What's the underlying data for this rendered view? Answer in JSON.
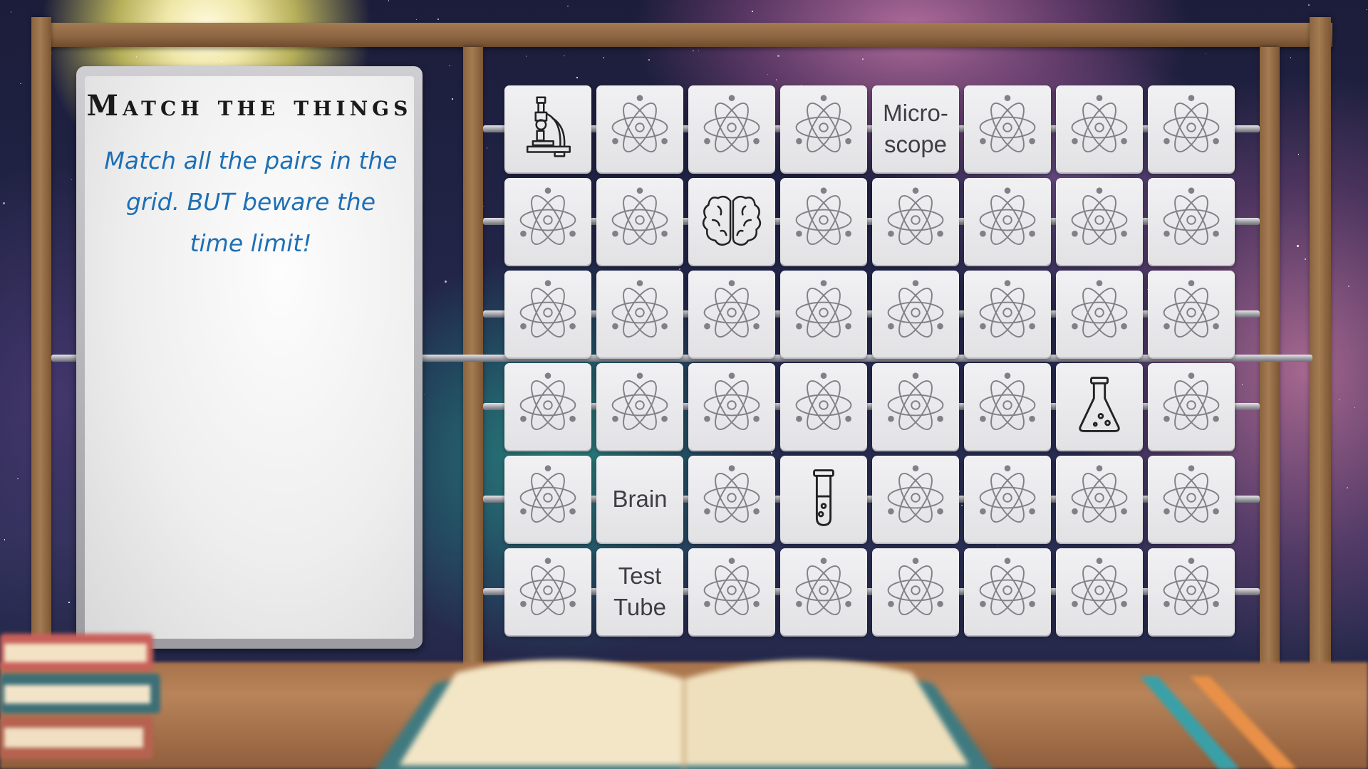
{
  "game": {
    "title": "Match the things",
    "instructions": "Match all the pairs in the grid. BUT beware the time limit!"
  },
  "colors": {
    "instruction_text": "#1e6fb5",
    "card_face": "#ececee",
    "card_icon": "#808086",
    "frame_wood": "#9a714a"
  },
  "grid": {
    "columns": 8,
    "rows": 6,
    "cards": [
      {
        "state": "revealed",
        "kind": "icon",
        "icon": "microscope-icon"
      },
      {
        "state": "hidden",
        "kind": "icon",
        "icon": "atom-icon"
      },
      {
        "state": "hidden",
        "kind": "icon",
        "icon": "atom-icon"
      },
      {
        "state": "hidden",
        "kind": "icon",
        "icon": "atom-icon"
      },
      {
        "state": "revealed",
        "kind": "text",
        "text": "Micro-\nscope"
      },
      {
        "state": "hidden",
        "kind": "icon",
        "icon": "atom-icon"
      },
      {
        "state": "hidden",
        "kind": "icon",
        "icon": "atom-icon"
      },
      {
        "state": "hidden",
        "kind": "icon",
        "icon": "atom-icon"
      },
      {
        "state": "hidden",
        "kind": "icon",
        "icon": "atom-icon"
      },
      {
        "state": "hidden",
        "kind": "icon",
        "icon": "atom-icon"
      },
      {
        "state": "revealed",
        "kind": "icon",
        "icon": "brain-icon"
      },
      {
        "state": "hidden",
        "kind": "icon",
        "icon": "atom-icon"
      },
      {
        "state": "hidden",
        "kind": "icon",
        "icon": "atom-icon"
      },
      {
        "state": "hidden",
        "kind": "icon",
        "icon": "atom-icon"
      },
      {
        "state": "hidden",
        "kind": "icon",
        "icon": "atom-icon"
      },
      {
        "state": "hidden",
        "kind": "icon",
        "icon": "atom-icon"
      },
      {
        "state": "hidden",
        "kind": "icon",
        "icon": "atom-icon"
      },
      {
        "state": "hidden",
        "kind": "icon",
        "icon": "atom-icon"
      },
      {
        "state": "hidden",
        "kind": "icon",
        "icon": "atom-icon"
      },
      {
        "state": "hidden",
        "kind": "icon",
        "icon": "atom-icon"
      },
      {
        "state": "hidden",
        "kind": "icon",
        "icon": "atom-icon"
      },
      {
        "state": "hidden",
        "kind": "icon",
        "icon": "atom-icon"
      },
      {
        "state": "hidden",
        "kind": "icon",
        "icon": "atom-icon"
      },
      {
        "state": "hidden",
        "kind": "icon",
        "icon": "atom-icon"
      },
      {
        "state": "hidden",
        "kind": "icon",
        "icon": "atom-icon"
      },
      {
        "state": "hidden",
        "kind": "icon",
        "icon": "atom-icon"
      },
      {
        "state": "hidden",
        "kind": "icon",
        "icon": "atom-icon"
      },
      {
        "state": "hidden",
        "kind": "icon",
        "icon": "atom-icon"
      },
      {
        "state": "hidden",
        "kind": "icon",
        "icon": "atom-icon"
      },
      {
        "state": "hidden",
        "kind": "icon",
        "icon": "atom-icon"
      },
      {
        "state": "revealed",
        "kind": "icon",
        "icon": "flask-icon"
      },
      {
        "state": "hidden",
        "kind": "icon",
        "icon": "atom-icon"
      },
      {
        "state": "hidden",
        "kind": "icon",
        "icon": "atom-icon"
      },
      {
        "state": "revealed",
        "kind": "text",
        "text": "Brain"
      },
      {
        "state": "hidden",
        "kind": "icon",
        "icon": "atom-icon"
      },
      {
        "state": "revealed",
        "kind": "icon",
        "icon": "test-tube-icon"
      },
      {
        "state": "hidden",
        "kind": "icon",
        "icon": "atom-icon"
      },
      {
        "state": "hidden",
        "kind": "icon",
        "icon": "atom-icon"
      },
      {
        "state": "hidden",
        "kind": "icon",
        "icon": "atom-icon"
      },
      {
        "state": "hidden",
        "kind": "icon",
        "icon": "atom-icon"
      },
      {
        "state": "hidden",
        "kind": "icon",
        "icon": "atom-icon"
      },
      {
        "state": "revealed",
        "kind": "text",
        "text": "Test\nTube"
      },
      {
        "state": "hidden",
        "kind": "icon",
        "icon": "atom-icon"
      },
      {
        "state": "hidden",
        "kind": "icon",
        "icon": "atom-icon"
      },
      {
        "state": "hidden",
        "kind": "icon",
        "icon": "atom-icon"
      },
      {
        "state": "hidden",
        "kind": "icon",
        "icon": "atom-icon"
      },
      {
        "state": "hidden",
        "kind": "icon",
        "icon": "atom-icon"
      },
      {
        "state": "hidden",
        "kind": "icon",
        "icon": "atom-icon"
      }
    ]
  }
}
